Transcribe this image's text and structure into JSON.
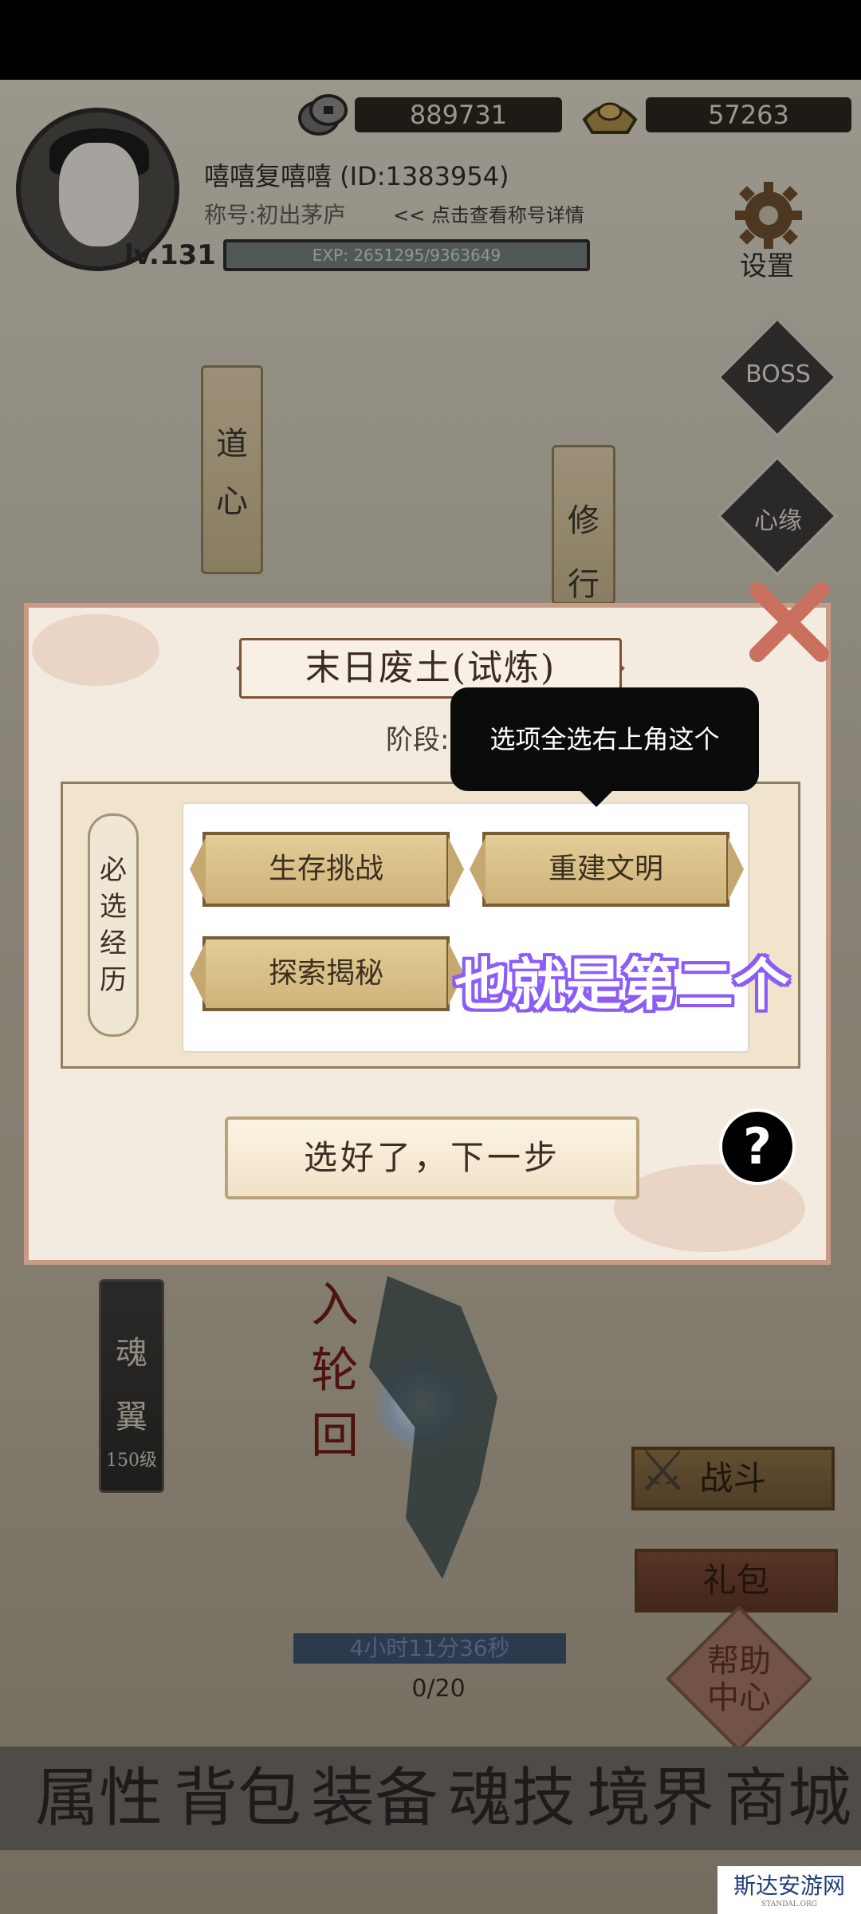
{
  "header": {
    "coins": "889731",
    "gold": "57263",
    "player_name": "嘻嘻复嘻嘻 (ID:1383954)",
    "title_label": "称号:初出茅庐",
    "title_link": "<< 点击查看称号详情",
    "level": "lv.131",
    "exp": "EXP: 2651295/9363649",
    "settings_label": "设置"
  },
  "side_left": {
    "daoxin": [
      "道",
      "心"
    ],
    "wing_chars": [
      "魂",
      "翼"
    ],
    "wing_level": "150级"
  },
  "side_right": {
    "xiuxing": [
      "修",
      "行"
    ],
    "boss": "BOSS",
    "xinyuan": "心缘"
  },
  "modal": {
    "title": "末日废土(试炼)",
    "stage_label": "阶段:",
    "section_label": [
      "必",
      "选",
      "经",
      "历"
    ],
    "options": [
      "生存挑战",
      "重建文明",
      "探索揭秘"
    ],
    "next_button": "选好了，下一步",
    "help_icon": "?"
  },
  "tooltip": "选项全选右上角这个",
  "caption": "也就是第二个",
  "scene": {
    "rebirth_chars": [
      "入",
      "轮",
      "回"
    ],
    "timer": "4小时11分36秒",
    "progress": "0/20",
    "battle_button": "战斗",
    "gift_button": "礼包",
    "help_center": [
      "帮助",
      "中心"
    ]
  },
  "bottom_nav": [
    "属性",
    "背包",
    "装备",
    "魂技",
    "境界",
    "商城"
  ],
  "watermark": {
    "text": "斯达安游网",
    "sub": "STANDAL.ORG"
  }
}
